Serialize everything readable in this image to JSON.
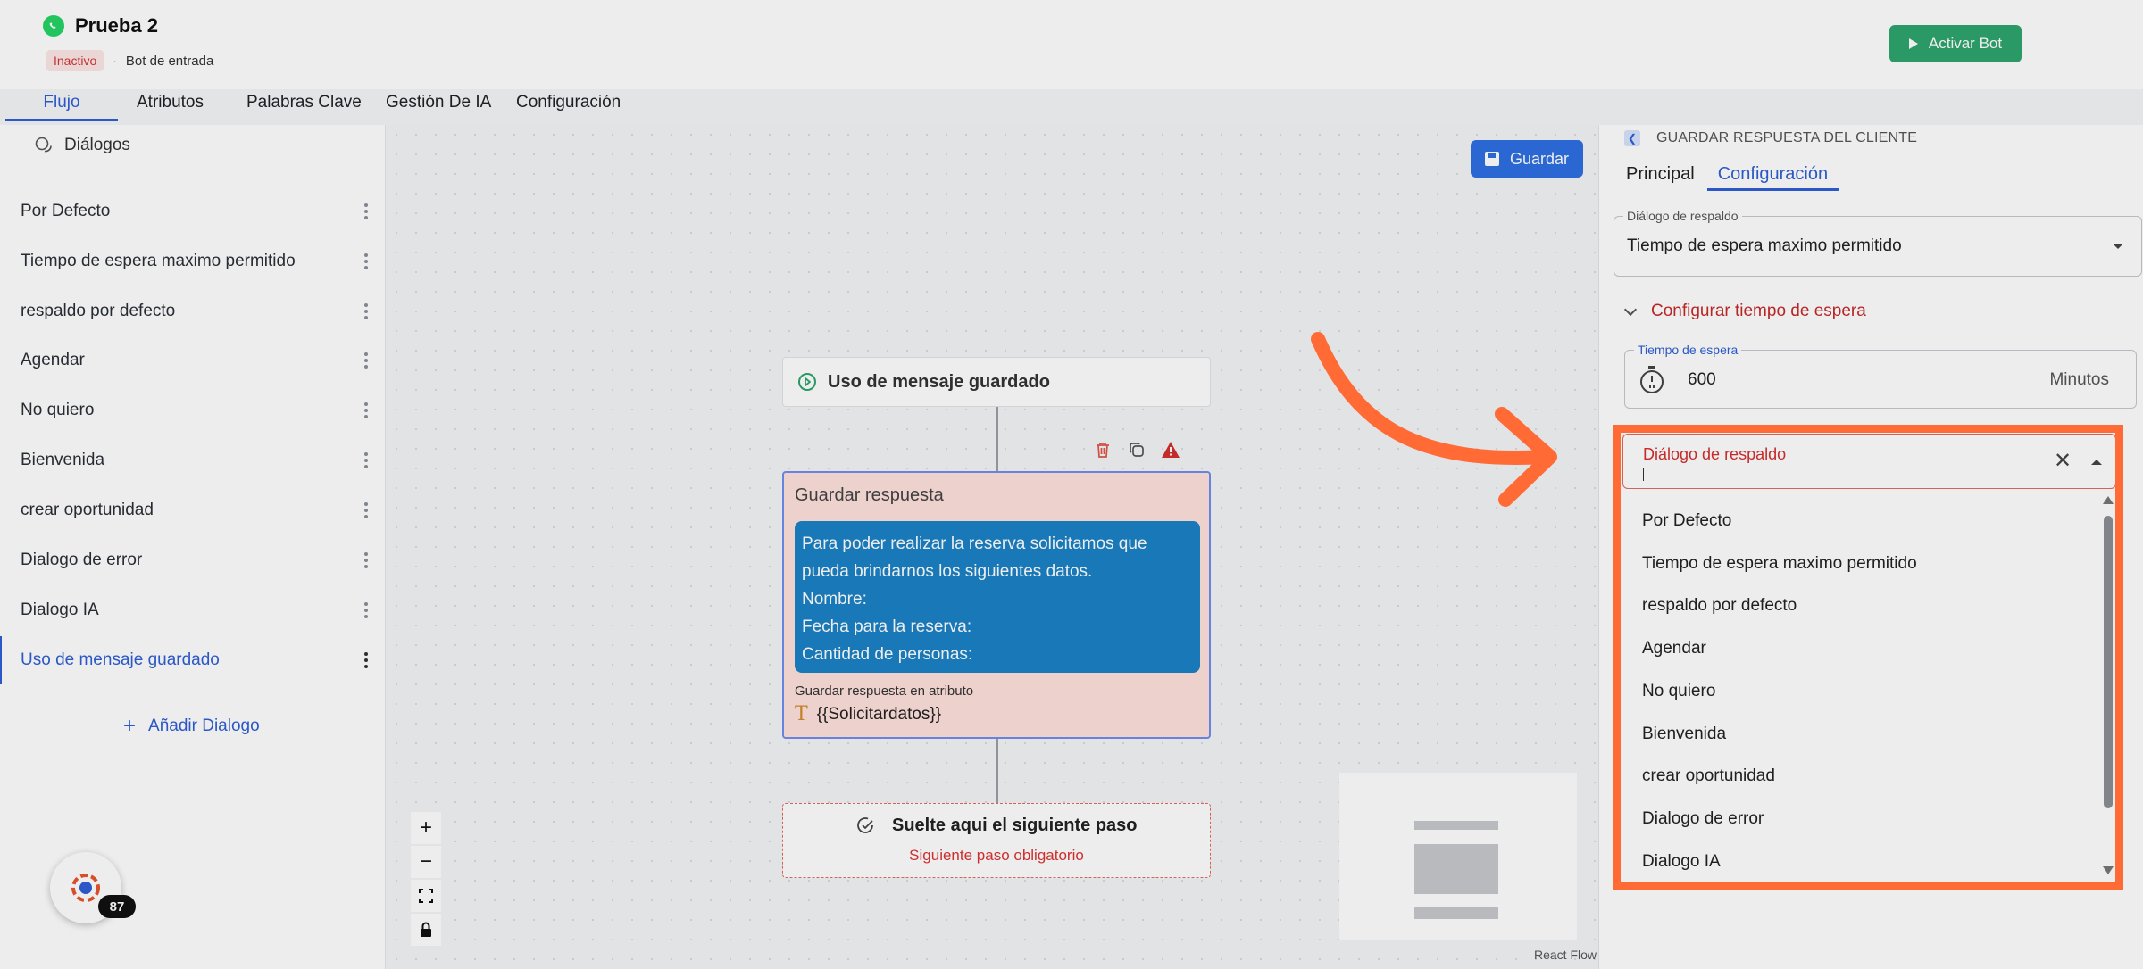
{
  "header": {
    "bot_name": "Prueba 2",
    "status": "Inactivo",
    "separator": "·",
    "bot_type": "Bot de entrada",
    "activate_label": "Activar Bot"
  },
  "tabs": [
    {
      "label": "Flujo",
      "active": true
    },
    {
      "label": "Atributos"
    },
    {
      "label": "Palabras Clave"
    },
    {
      "label": "Gestión De IA"
    },
    {
      "label": "Configuración"
    }
  ],
  "sidebar": {
    "title": "Diálogos",
    "items": [
      {
        "label": "Por Defecto"
      },
      {
        "label": "Tiempo de espera maximo permitido"
      },
      {
        "label": "respaldo por defecto"
      },
      {
        "label": "Agendar"
      },
      {
        "label": "No quiero"
      },
      {
        "label": "Bienvenida"
      },
      {
        "label": "crear oportunidad"
      },
      {
        "label": "Dialogo de error"
      },
      {
        "label": "Dialogo IA"
      },
      {
        "label": "Uso de mensaje guardado",
        "active": true
      }
    ],
    "add_label": "Añadir Dialogo",
    "avatar_count": "87"
  },
  "canvas": {
    "save_label": "Guardar",
    "start_node_label": "Uso de mensaje guardado",
    "save_node": {
      "title": "Guardar respuesta",
      "message_lines": [
        "Para poder realizar la reserva solicitamos que",
        "pueda brindarnos los siguientes datos.",
        "Nombre:",
        "Fecha para la reserva:",
        "Cantidad de personas:"
      ],
      "attr_label": "Guardar respuesta en atributo",
      "attr_value": "{{Solicitardatos}}"
    },
    "drop_node": {
      "title": "Suelte aqui el siguiente paso",
      "subtitle": "Siguiente paso obligatorio"
    },
    "react_flow_label": "React Flow"
  },
  "right_panel": {
    "header": "GUARDAR RESPUESTA DEL CLIENTE",
    "tabs": [
      {
        "label": "Principal"
      },
      {
        "label": "Configuración",
        "active": true
      }
    ],
    "fallback_label": "Diálogo de respaldo",
    "fallback_value": "Tiempo de espera maximo permitido",
    "configure_label": "Configurar tiempo de espera",
    "timeout_label": "Tiempo de espera",
    "timeout_value": "600",
    "timeout_unit": "Minutos"
  },
  "dropdown": {
    "label": "Diálogo de respaldo",
    "options": [
      "Por Defecto",
      "Tiempo de espera maximo permitido",
      "respaldo por defecto",
      "Agendar",
      "No quiero",
      "Bienvenida",
      "crear oportunidad",
      "Dialogo de error",
      "Dialogo IA"
    ]
  },
  "colors": {
    "accent": "#2f5fd6",
    "activate": "#2ea56d",
    "highlight": "#ff6a35",
    "message_bubble": "#1a82c6",
    "error": "#d32f2f"
  }
}
